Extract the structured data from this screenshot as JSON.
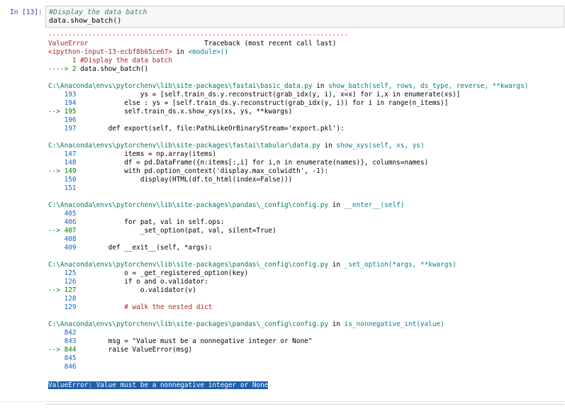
{
  "cell": {
    "prompt": "In [13]:",
    "code": [
      "#Display the data batch",
      "data.show_batch()"
    ]
  },
  "traceback": {
    "separator": "---------------------------------------------------------------------------",
    "error_type": "ValueError",
    "traceback_label": "Traceback (most recent call last)",
    "input_ref": "<ipython-input-13-ecbf8b65ce67>",
    "in_word": "in",
    "module": "<module>()",
    "frame0_line1": "      1 #Display the data batch",
    "frame0_line2_arrow": "----> 2",
    "frame0_line2_code": " data.show_batch()",
    "frames": [
      {
        "path": "C:\\Anaconda\\envs\\pytorchenv\\lib\\site-packages\\fastai\\basic_data.py",
        "in": "in",
        "func": "show_batch(self, rows, ds_type, reverse, **kwargs)",
        "lines": [
          {
            "no": "    193",
            "code": "                ys = [self.train_ds.y.reconstruct(grab_idx(y, i), x=x) for i,x in enumerate(xs)]"
          },
          {
            "no": "    194",
            "code": "            else : ys = [self.train_ds.y.reconstruct(grab_idx(y, i)) for i in range(n_items)]"
          },
          {
            "no": "--> 195",
            "code": "            self.train_ds.x.show_xys(xs, ys, **kwargs)"
          },
          {
            "no": "    196",
            "code": ""
          },
          {
            "no": "    197",
            "code": "        def export(self, file:PathLikeOrBinaryStream='export.pkl'):"
          }
        ]
      },
      {
        "path": "C:\\Anaconda\\envs\\pytorchenv\\lib\\site-packages\\fastai\\tabular\\data.py",
        "in": "in",
        "func": "show_xys(self, xs, ys)",
        "lines": [
          {
            "no": "    147",
            "code": "            items = np.array(items)"
          },
          {
            "no": "    148",
            "code": "            df = pd.DataFrame({n:items[:,i] for i,n in enumerate(names)}, columns=names)"
          },
          {
            "no": "--> 149",
            "code": "            with pd.option_context('display.max_colwidth', -1):"
          },
          {
            "no": "    150",
            "code": "                display(HTML(df.to_html(index=False)))"
          },
          {
            "no": "    151",
            "code": ""
          }
        ]
      },
      {
        "path": "C:\\Anaconda\\envs\\pytorchenv\\lib\\site-packages\\pandas\\_config\\config.py",
        "in": "in",
        "func": "__enter__(self)",
        "lines": [
          {
            "no": "    405",
            "code": ""
          },
          {
            "no": "    406",
            "code": "            for pat, val in self.ops:"
          },
          {
            "no": "--> 407",
            "code": "                _set_option(pat, val, silent=True)"
          },
          {
            "no": "    408",
            "code": ""
          },
          {
            "no": "    409",
            "code": "        def __exit__(self, *args):"
          }
        ]
      },
      {
        "path": "C:\\Anaconda\\envs\\pytorchenv\\lib\\site-packages\\pandas\\_config\\config.py",
        "in": "in",
        "func": "_set_option(*args, **kwargs)",
        "lines": [
          {
            "no": "    125",
            "code": "            o = _get_registered_option(key)"
          },
          {
            "no": "    126",
            "code": "            if o and o.validator:"
          },
          {
            "no": "--> 127",
            "code": "                o.validator(v)"
          },
          {
            "no": "    128",
            "code": ""
          },
          {
            "no": "    129",
            "code": "            # walk the nested dict"
          }
        ]
      },
      {
        "path": "C:\\Anaconda\\envs\\pytorchenv\\lib\\site-packages\\pandas\\_config\\config.py",
        "in": "in",
        "func": "is_nonnegative_int(value)",
        "lines": [
          {
            "no": "    842",
            "code": ""
          },
          {
            "no": "    843",
            "code": "        msg = \"Value must be a nonnegative integer or None\""
          },
          {
            "no": "--> 844",
            "code": "        raise ValueError(msg)"
          },
          {
            "no": "    845",
            "code": ""
          },
          {
            "no": "    846",
            "code": ""
          }
        ]
      }
    ],
    "final_error": "ValueError: Value must be a nonnegative integer or None"
  },
  "colors": {
    "prompt": "#303f9f",
    "error_red": "#d32f2f",
    "path_teal": "#00796b",
    "func_cyan": "#00838f",
    "arrow_green": "#008000",
    "selection_blue": "#1f5fb0"
  }
}
